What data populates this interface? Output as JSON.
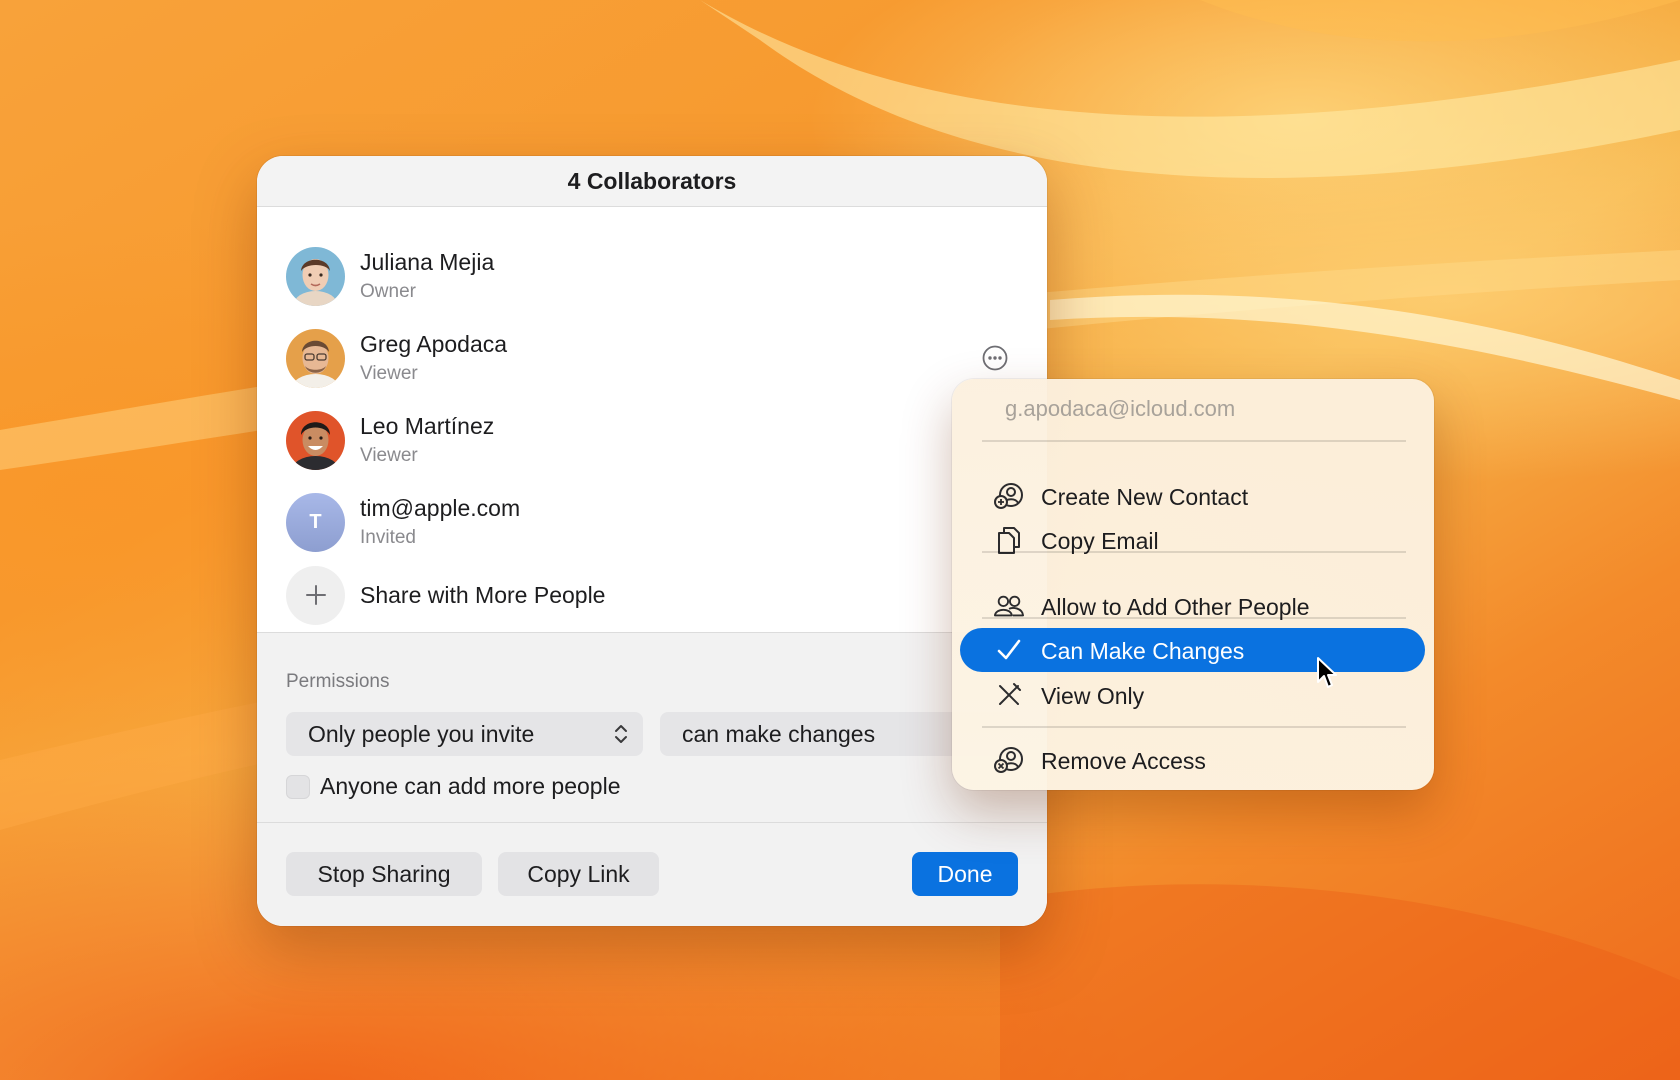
{
  "dialog": {
    "title": "4 Collaborators",
    "people": [
      {
        "name": "Juliana Mejia",
        "role": "Owner"
      },
      {
        "name": "Greg Apodaca",
        "role": "Viewer"
      },
      {
        "name": "Leo Martínez",
        "role": "Viewer"
      },
      {
        "name": "tim@apple.com",
        "role": "Invited",
        "initial": "T"
      }
    ],
    "add_label": "Share with More People",
    "permissions": {
      "title": "Permissions",
      "who_value": "Only people you invite",
      "level_value": "can make changes",
      "checkbox_label": "Anyone can add more people",
      "checkbox_checked": false
    },
    "buttons": {
      "stop_sharing": "Stop Sharing",
      "copy_link": "Copy Link",
      "done": "Done"
    }
  },
  "menu": {
    "email": "g.apodaca@icloud.com",
    "items": [
      {
        "label": "Create New Contact",
        "icon": "person-add-icon"
      },
      {
        "label": "Copy Email",
        "icon": "copy-icon"
      },
      {
        "label": "Allow to Add Other People",
        "icon": "people-icon"
      },
      {
        "label": "Can Make Changes",
        "icon": "checkmark-icon",
        "selected": true
      },
      {
        "label": "View Only",
        "icon": "pencil-slash-icon"
      },
      {
        "label": "Remove Access",
        "icon": "person-remove-icon"
      }
    ]
  },
  "colors": {
    "accent": "#0a72e0",
    "background_orange": "#f79a2f"
  }
}
